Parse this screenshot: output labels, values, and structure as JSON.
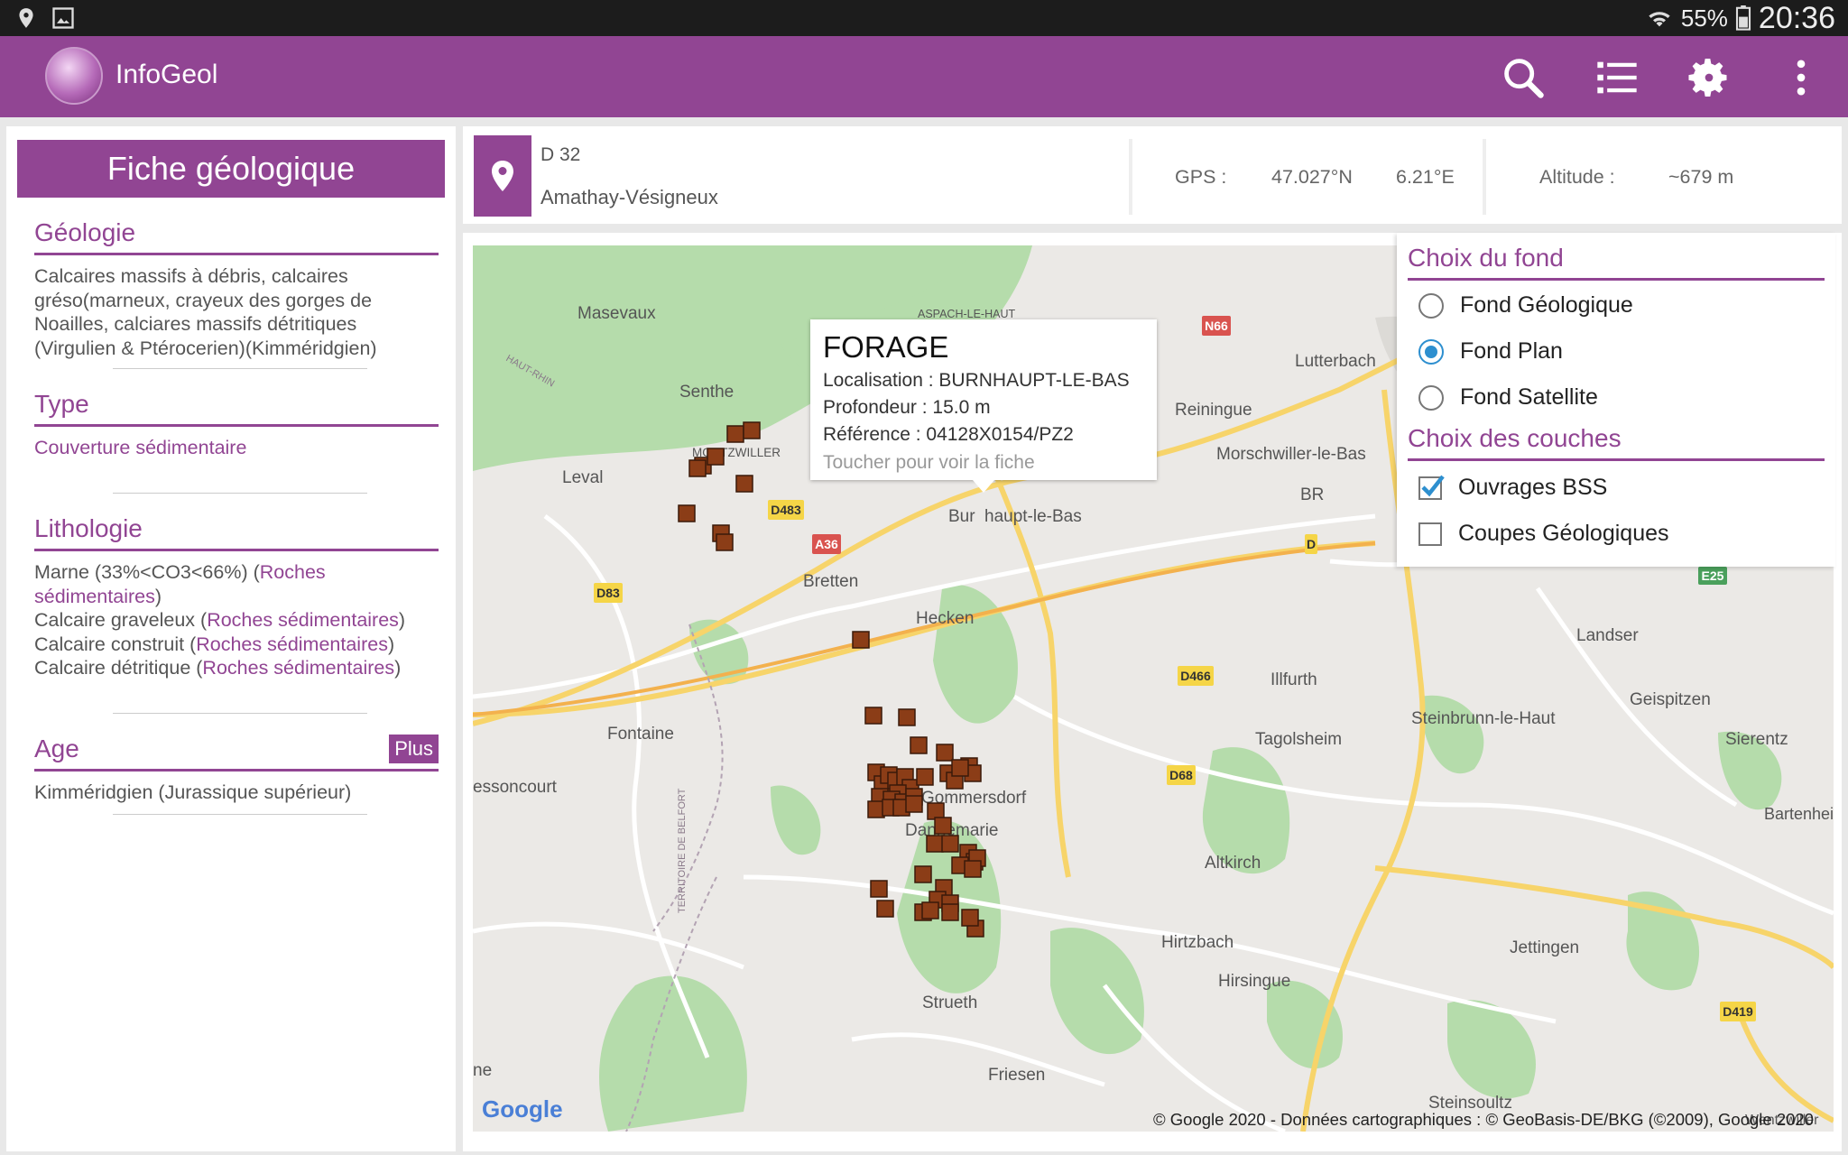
{
  "status_bar": {
    "battery": "55%",
    "time": "20:36",
    "icons": [
      "location-icon",
      "image-icon",
      "wifi-icon",
      "battery-icon"
    ]
  },
  "app": {
    "title": "InfoGeol",
    "actions": [
      "search-icon",
      "list-icon",
      "gear-icon",
      "more-vert-icon"
    ],
    "accent": "#914593"
  },
  "fiche": {
    "header": "Fiche géologique",
    "geologie": {
      "title": "Géologie",
      "text": "Calcaires massifs à débris, calcaires gréso(marneux, crayeux des gorges de Noailles, calciares massifs détritiques (Virgulien & Ptérocerien)(Kimméridgien)"
    },
    "type": {
      "title": "Type",
      "value": "Couverture sédimentaire"
    },
    "lithologie": {
      "title": "Lithologie",
      "items": [
        {
          "name": "Marne (33%<CO3<66%) (",
          "link": "Roches sédimentaires",
          "end": ")"
        },
        {
          "name": "Calcaire graveleux (",
          "link": "Roches sédimentaires",
          "end": ")"
        },
        {
          "name": "Calcaire construit (",
          "link": "Roches sédimentaires",
          "end": ")"
        },
        {
          "name": "Calcaire détritique (",
          "link": "Roches sédimentaires",
          "end": ")"
        }
      ]
    },
    "age": {
      "title": "Age",
      "plus_label": "Plus",
      "value": "Kimméridgien (Jurassique supérieur)"
    }
  },
  "location": {
    "road": "D 32",
    "commune": "Amathay-Vésigneux",
    "gps_label": "GPS :",
    "lat": "47.027°N",
    "lon": "6.21°E",
    "alt_label": "Altitude :",
    "alt": "~679 m"
  },
  "layers": {
    "fond_title": "Choix du fond",
    "fonds": [
      {
        "label": "Fond Géologique",
        "selected": false
      },
      {
        "label": "Fond Plan",
        "selected": true
      },
      {
        "label": "Fond Satellite",
        "selected": false
      }
    ],
    "couches_title": "Choix des couches",
    "couches": [
      {
        "label": "Ouvrages BSS",
        "checked": true
      },
      {
        "label": "Coupes Géologiques",
        "checked": false
      }
    ]
  },
  "popup": {
    "title": "FORAGE",
    "localisation": "Localisation : BURNHAUPT-LE-BAS",
    "profondeur": "Profondeur : 15.0 m",
    "reference": "Référence : 04128X0154/PZ2",
    "hint": "Toucher pour voir la fiche"
  },
  "map": {
    "towns": [
      "Masevaux",
      "Senthe",
      "ASPACH-LE-HAUT",
      "Lutterbach",
      "Reiningue",
      "Morschwiller-le-Bas",
      "BR",
      "MORTZWILLER",
      "Leval",
      "Bur",
      "haupt-le-Bas",
      "Bretten",
      "Hecken",
      "Landser",
      "Illfurth",
      "Geispitzen",
      "Steinbrunn-le-Haut",
      "Sierentz",
      "Tagolsheim",
      "Fontaine",
      "essoncourt",
      "Gommersdorf",
      "Dannemarie",
      "Altkirch",
      "Bartenhei",
      "Hirtzbach",
      "Jettingen",
      "Hirsingue",
      "Strueth",
      "Friesen",
      "ne",
      "Steinsoultz",
      "HAUT-RHIN",
      "TERRITOIRE DE BELFORT",
      "Wentzwiller"
    ],
    "roads": [
      "N66",
      "D483",
      "A36",
      "D83",
      "D466",
      "D68",
      "D419",
      "E25",
      "D"
    ],
    "logo": "Google",
    "copyright": "© Google 2020 - Données cartographiques : © GeoBasis-DE/BKG (©2009), Google 2020"
  }
}
